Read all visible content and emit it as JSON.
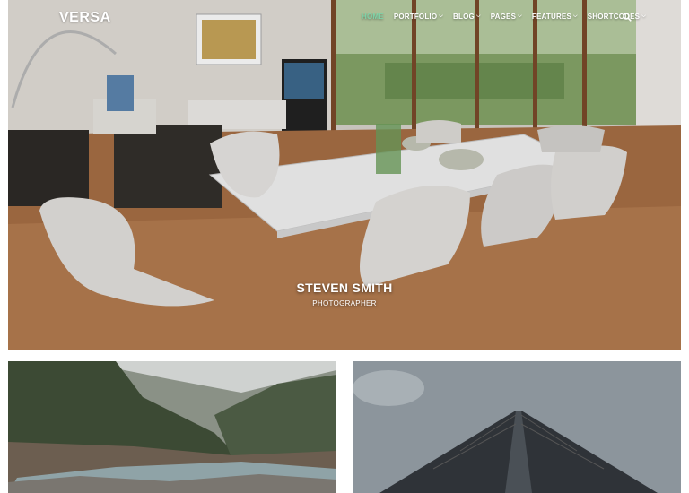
{
  "header": {
    "logo": "VERSA",
    "nav": [
      {
        "label": "HOME",
        "active": true,
        "has_dropdown": false
      },
      {
        "label": "PORTFOLIO",
        "active": false,
        "has_dropdown": true
      },
      {
        "label": "BLOG",
        "active": false,
        "has_dropdown": true
      },
      {
        "label": "PAGES",
        "active": false,
        "has_dropdown": true
      },
      {
        "label": "FEATURES",
        "active": false,
        "has_dropdown": true
      },
      {
        "label": "SHORTCODES",
        "active": false,
        "has_dropdown": true
      }
    ],
    "search_icon": "search-icon",
    "chevron_icon": "chevron-down-icon"
  },
  "hero": {
    "title": "STEVEN SMITH",
    "subtitle": "PHOTOGRAPHER",
    "image": "dining-room-photo"
  },
  "grid": {
    "tiles": [
      {
        "image": "forest-river-photo"
      },
      {
        "image": "skyscraper-photo"
      }
    ]
  },
  "colors": {
    "nav_active": "#7fd3a8",
    "nav_text": "#ffffff",
    "page_background": "#ffffff"
  }
}
